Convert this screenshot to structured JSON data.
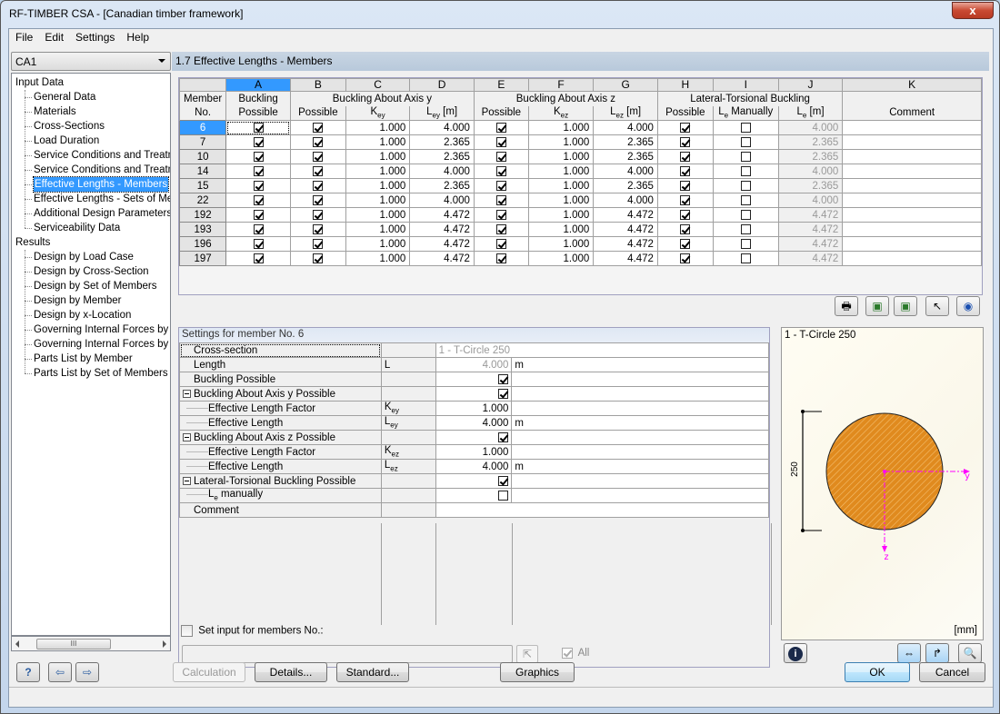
{
  "window": {
    "title": "RF-TIMBER CSA - [Canadian timber framework]",
    "close_label": "x"
  },
  "menu": [
    "File",
    "Edit",
    "Settings",
    "Help"
  ],
  "case_selector": {
    "value": "CA1"
  },
  "tree": {
    "input_root": "Input Data",
    "input_items": [
      "General Data",
      "Materials",
      "Cross-Sections",
      "Load Duration",
      "Service Conditions and Treatme",
      "Service Conditions and Treatme",
      "Effective Lengths - Members",
      "Effective Lengths - Sets of Mem",
      "Additional Design Parameters",
      "Serviceability Data"
    ],
    "selected_index": 6,
    "results_root": "Results",
    "result_items": [
      "Design by Load Case",
      "Design by Cross-Section",
      "Design by Set of Members",
      "Design by Member",
      "Design by x-Location",
      "Governing Internal Forces by M",
      "Governing Internal Forces by S",
      "Parts List by Member",
      "Parts List by Set of Members"
    ],
    "scroll_thumb": "III"
  },
  "section_title": "1.7 Effective Lengths - Members",
  "grid": {
    "letters": [
      "A",
      "B",
      "C",
      "D",
      "E",
      "F",
      "G",
      "H",
      "I",
      "J",
      "K"
    ],
    "header_member": [
      "Member",
      "No."
    ],
    "group_buckling": "Buckling",
    "group_axis_y": "Buckling About Axis y",
    "group_axis_z": "Buckling About Axis z",
    "group_ltb": "Lateral-Torsional Buckling",
    "sub_possible": "Possible",
    "sub_key": "Key",
    "sub_ley": "Ley [m]",
    "sub_kez": "Kez",
    "sub_lez": "Lez [m]",
    "sub_le_manually": "Le Manually",
    "sub_le": "Le [m]",
    "sub_comment": "Comment",
    "rows": [
      {
        "member": "6",
        "buckling": true,
        "y_possible": true,
        "key": "1.000",
        "ley": "4.000",
        "z_possible": true,
        "kez": "1.000",
        "lez": "4.000",
        "ltb_possible": true,
        "le_manual": false,
        "le": "4.000",
        "comment": ""
      },
      {
        "member": "7",
        "buckling": true,
        "y_possible": true,
        "key": "1.000",
        "ley": "2.365",
        "z_possible": true,
        "kez": "1.000",
        "lez": "2.365",
        "ltb_possible": true,
        "le_manual": false,
        "le": "2.365",
        "comment": ""
      },
      {
        "member": "10",
        "buckling": true,
        "y_possible": true,
        "key": "1.000",
        "ley": "2.365",
        "z_possible": true,
        "kez": "1.000",
        "lez": "2.365",
        "ltb_possible": true,
        "le_manual": false,
        "le": "2.365",
        "comment": ""
      },
      {
        "member": "14",
        "buckling": true,
        "y_possible": true,
        "key": "1.000",
        "ley": "4.000",
        "z_possible": true,
        "kez": "1.000",
        "lez": "4.000",
        "ltb_possible": true,
        "le_manual": false,
        "le": "4.000",
        "comment": ""
      },
      {
        "member": "15",
        "buckling": true,
        "y_possible": true,
        "key": "1.000",
        "ley": "2.365",
        "z_possible": true,
        "kez": "1.000",
        "lez": "2.365",
        "ltb_possible": true,
        "le_manual": false,
        "le": "2.365",
        "comment": ""
      },
      {
        "member": "22",
        "buckling": true,
        "y_possible": true,
        "key": "1.000",
        "ley": "4.000",
        "z_possible": true,
        "kez": "1.000",
        "lez": "4.000",
        "ltb_possible": true,
        "le_manual": false,
        "le": "4.000",
        "comment": ""
      },
      {
        "member": "192",
        "buckling": true,
        "y_possible": true,
        "key": "1.000",
        "ley": "4.472",
        "z_possible": true,
        "kez": "1.000",
        "lez": "4.472",
        "ltb_possible": true,
        "le_manual": false,
        "le": "4.472",
        "comment": ""
      },
      {
        "member": "193",
        "buckling": true,
        "y_possible": true,
        "key": "1.000",
        "ley": "4.472",
        "z_possible": true,
        "kez": "1.000",
        "lez": "4.472",
        "ltb_possible": true,
        "le_manual": false,
        "le": "4.472",
        "comment": ""
      },
      {
        "member": "196",
        "buckling": true,
        "y_possible": true,
        "key": "1.000",
        "ley": "4.472",
        "z_possible": true,
        "kez": "1.000",
        "lez": "4.472",
        "ltb_possible": true,
        "le_manual": false,
        "le": "4.472",
        "comment": ""
      },
      {
        "member": "197",
        "buckling": true,
        "y_possible": true,
        "key": "1.000",
        "ley": "4.472",
        "z_possible": true,
        "kez": "1.000",
        "lez": "4.472",
        "ltb_possible": true,
        "le_manual": false,
        "le": "4.472",
        "comment": ""
      }
    ],
    "toolbar_icons": [
      "print-icon",
      "excel-export-icon",
      "excel-import-icon",
      "select-member-icon",
      "view-icon"
    ]
  },
  "settings": {
    "title": "Settings for member No. 6",
    "rows": [
      {
        "label": "Cross-section",
        "symbol": "",
        "value": "1 - T-Circle 250",
        "unit": "",
        "type": "text-gray",
        "indent": 0
      },
      {
        "label": "Length",
        "symbol": "L",
        "value": "4.000",
        "unit": "m",
        "type": "gray",
        "indent": 0
      },
      {
        "label": "Buckling Possible",
        "symbol": "",
        "value": true,
        "unit": "",
        "type": "check",
        "indent": 0
      },
      {
        "label": "Buckling About Axis y Possible",
        "symbol": "",
        "value": true,
        "unit": "",
        "type": "check",
        "indent": -1
      },
      {
        "label": "Effective Length Factor",
        "symbol": "Key",
        "value": "1.000",
        "unit": "",
        "type": "num",
        "indent": 1
      },
      {
        "label": "Effective Length",
        "symbol": "Ley",
        "value": "4.000",
        "unit": "m",
        "type": "num",
        "indent": 1
      },
      {
        "label": "Buckling About Axis z Possible",
        "symbol": "",
        "value": true,
        "unit": "",
        "type": "check",
        "indent": -1
      },
      {
        "label": "Effective Length Factor",
        "symbol": "Kez",
        "value": "1.000",
        "unit": "",
        "type": "num",
        "indent": 1
      },
      {
        "label": "Effective Length",
        "symbol": "Lez",
        "value": "4.000",
        "unit": "m",
        "type": "num",
        "indent": 1
      },
      {
        "label": "Lateral-Torsional Buckling Possible",
        "symbol": "",
        "value": true,
        "unit": "",
        "type": "check",
        "indent": -1
      },
      {
        "label": "Le manually",
        "symbol": "",
        "value": false,
        "unit": "",
        "type": "check",
        "indent": 1
      },
      {
        "label": "Comment",
        "symbol": "",
        "value": "",
        "unit": "",
        "type": "text",
        "indent": 0
      }
    ],
    "set_input_label": "Set input for members No.:",
    "set_input_checked": false,
    "members_input_value": "",
    "all_label": "All",
    "all_checked": true
  },
  "graphic": {
    "title": "1 - T-Circle 250",
    "dimension_label": "250",
    "axis_y": "y",
    "axis_z": "z",
    "units": "[mm]",
    "colors": {
      "fill": "#e08a1e",
      "axis": "#ff00ff"
    }
  },
  "buttons": {
    "calculation": "Calculation",
    "details": "Details...",
    "standard": "Standard...",
    "graphics": "Graphics",
    "ok": "OK",
    "cancel": "Cancel"
  }
}
